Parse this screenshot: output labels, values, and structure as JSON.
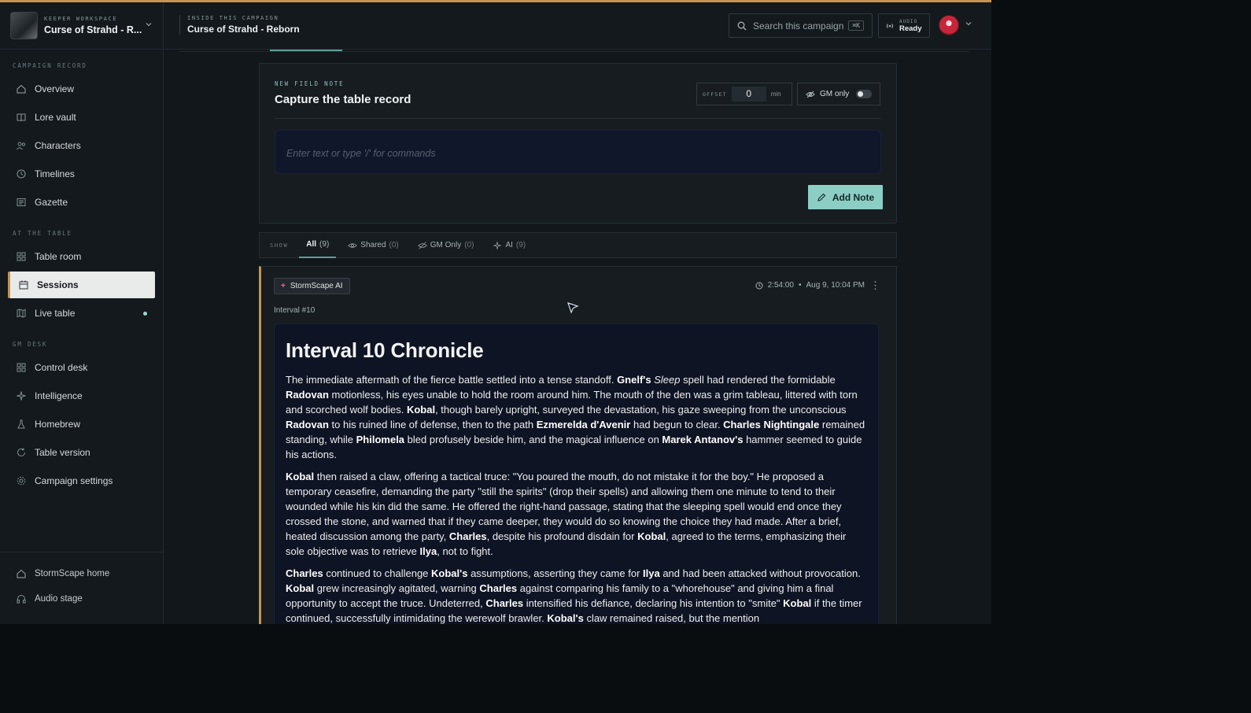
{
  "workspace": {
    "kicker": "KEEPER WORKSPACE",
    "name": "Curse of Strahd - R..."
  },
  "header": {
    "kicker": "INSIDE THIS CAMPAIGN",
    "title": "Curse of Strahd - Reborn",
    "search_placeholder": "Search this campaign",
    "search_shortcut": "⌘K",
    "audio_kicker": "AUDIO",
    "audio_status": "Ready"
  },
  "sidebar": {
    "sections": [
      {
        "label": "CAMPAIGN RECORD",
        "items": [
          {
            "label": "Overview",
            "icon": "home-icon"
          },
          {
            "label": "Lore vault",
            "icon": "book-icon"
          },
          {
            "label": "Characters",
            "icon": "users-icon"
          },
          {
            "label": "Timelines",
            "icon": "clock-icon"
          },
          {
            "label": "Gazette",
            "icon": "newspaper-icon"
          }
        ]
      },
      {
        "label": "AT THE TABLE",
        "items": [
          {
            "label": "Table room",
            "icon": "grid-icon"
          },
          {
            "label": "Sessions",
            "icon": "calendar-icon",
            "active": true
          },
          {
            "label": "Live table",
            "icon": "map-icon",
            "live": true
          }
        ]
      },
      {
        "label": "GM DESK",
        "items": [
          {
            "label": "Control desk",
            "icon": "grid-icon"
          },
          {
            "label": "Intelligence",
            "icon": "sparkles-icon"
          },
          {
            "label": "Homebrew",
            "icon": "flask-icon"
          },
          {
            "label": "Table version",
            "icon": "refresh-icon"
          },
          {
            "label": "Campaign settings",
            "icon": "gear-icon"
          }
        ]
      }
    ],
    "bottom": [
      {
        "label": "StormScape home",
        "icon": "home-icon"
      },
      {
        "label": "Audio stage",
        "icon": "headphones-icon"
      }
    ]
  },
  "note_card": {
    "kicker": "NEW FIELD NOTE",
    "title": "Capture the table record",
    "offset_label": "OFFSET",
    "offset_value": "0",
    "offset_unit": "min",
    "gm_only_label": "GM only",
    "gm_only_on": false,
    "editor_placeholder": "Enter text or type '/' for commands",
    "add_button": "Add Note"
  },
  "filters": {
    "label": "SHOW",
    "tabs": [
      {
        "label": "All",
        "count": "(9)",
        "active": true,
        "icon": ""
      },
      {
        "label": "Shared",
        "count": "(0)",
        "icon": "eye-icon"
      },
      {
        "label": "GM Only",
        "count": "(0)",
        "icon": "eye-off-icon"
      },
      {
        "label": "AI",
        "count": "(9)",
        "icon": "sparkles-icon"
      }
    ]
  },
  "entry": {
    "badge": "StormScape AI",
    "time": "2:54:00",
    "date": "Aug 9, 10:04 PM",
    "interval": "Interval #10",
    "heading": "Interval 10 Chronicle",
    "paragraphs": [
      [
        {
          "t": "The immediate aftermath of the fierce battle settled into a tense standoff. "
        },
        {
          "t": "Gnelf's",
          "b": true
        },
        {
          "t": " "
        },
        {
          "t": "Sleep",
          "i": true
        },
        {
          "t": " spell had rendered the formidable "
        },
        {
          "t": "Radovan",
          "b": true
        },
        {
          "t": " motionless, his eyes unable to hold the room around him. The mouth of the den was a grim tableau, littered with torn and scorched wolf bodies. "
        },
        {
          "t": "Kobal",
          "b": true
        },
        {
          "t": ", though barely upright, surveyed the devastation, his gaze sweeping from the unconscious "
        },
        {
          "t": "Radovan",
          "b": true
        },
        {
          "t": " to his ruined line of defense, then to the path "
        },
        {
          "t": "Ezmerelda d'Avenir",
          "b": true
        },
        {
          "t": " had begun to clear. "
        },
        {
          "t": "Charles Nightingale",
          "b": true
        },
        {
          "t": " remained standing, while "
        },
        {
          "t": "Philomela",
          "b": true
        },
        {
          "t": " bled profusely beside him, and the magical influence on "
        },
        {
          "t": "Marek Antanov's",
          "b": true
        },
        {
          "t": " hammer seemed to guide his actions."
        }
      ],
      [
        {
          "t": "Kobal",
          "b": true
        },
        {
          "t": " then raised a claw, offering a tactical truce: \"You poured the mouth, do not mistake it for the boy.\" He proposed a temporary ceasefire, demanding the party \"still the spirits\" (drop their spells) and allowing them one minute to tend to their wounded while his kin did the same. He offered the right-hand passage, stating that the sleeping spell would end once they crossed the stone, and warned that if they came deeper, they would do so knowing the choice they had made. After a brief, heated discussion among the party, "
        },
        {
          "t": "Charles",
          "b": true
        },
        {
          "t": ", despite his profound disdain for "
        },
        {
          "t": "Kobal",
          "b": true
        },
        {
          "t": ", agreed to the terms, emphasizing their sole objective was to retrieve "
        },
        {
          "t": "Ilya",
          "b": true
        },
        {
          "t": ", not to fight."
        }
      ],
      [
        {
          "t": "Charles",
          "b": true
        },
        {
          "t": " continued to challenge "
        },
        {
          "t": "Kobal's",
          "b": true
        },
        {
          "t": " assumptions, asserting they came for "
        },
        {
          "t": "Ilya",
          "b": true
        },
        {
          "t": " and had been attacked without provocation. "
        },
        {
          "t": "Kobal",
          "b": true
        },
        {
          "t": " grew increasingly agitated, warning "
        },
        {
          "t": "Charles",
          "b": true
        },
        {
          "t": " against comparing his family to a \"whorehouse\" and giving him a final opportunity to accept the truce. Undeterred, "
        },
        {
          "t": "Charles",
          "b": true
        },
        {
          "t": " intensified his defiance, declaring his intention to \"smite\" "
        },
        {
          "t": "Kobal",
          "b": true
        },
        {
          "t": " if the timer continued, successfully intimidating the werewolf brawler. "
        },
        {
          "t": "Kobal's",
          "b": true
        },
        {
          "t": " claw remained raised, but the mention"
        }
      ]
    ]
  },
  "colors": {
    "accent": "#c7934e",
    "teal": "#8ccdc4",
    "ai_spark": "#ff5fa0"
  }
}
